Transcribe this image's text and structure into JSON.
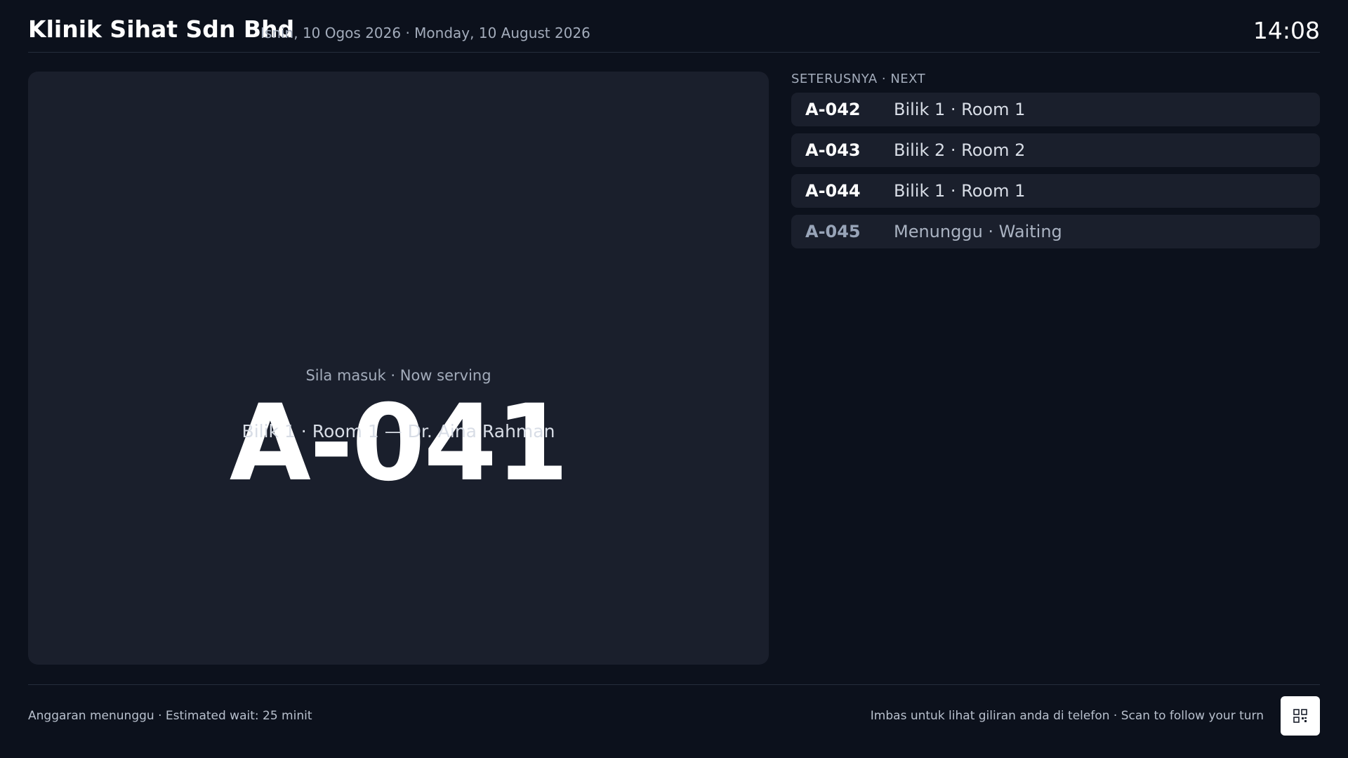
{
  "header": {
    "clinic_name": "Klinik Sihat Sdn Bhd",
    "date": "Isnin, 10 Ogos 2026 · Monday, 10 August 2026",
    "time": "14:08"
  },
  "now_serving": {
    "label": "Sila masuk · Now serving",
    "ticket": "A-041",
    "room": "Bilik 1 · Room 1 — Dr. Aina Rahman"
  },
  "next": {
    "title": "SETERUSNYA · NEXT",
    "items": [
      {
        "ticket": "A-042",
        "room": "Bilik 1 · Room 1"
      },
      {
        "ticket": "A-043",
        "room": "Bilik 2 · Room 2"
      },
      {
        "ticket": "A-044",
        "room": "Bilik 1 · Room 1"
      },
      {
        "ticket": "A-045",
        "room": "Menunggu · Waiting"
      }
    ]
  },
  "footer": {
    "estimated_wait": "Anggaran menunggu · Estimated wait: 25 minit",
    "scan_prompt": "Imbas untuk lihat giliran anda di telefon · Scan to follow your turn",
    "qr_icon": "qr-code-icon"
  },
  "colors": {
    "background": "#0c111c",
    "panel": "#1a1f2c",
    "muted_text": "#a3acbb"
  }
}
